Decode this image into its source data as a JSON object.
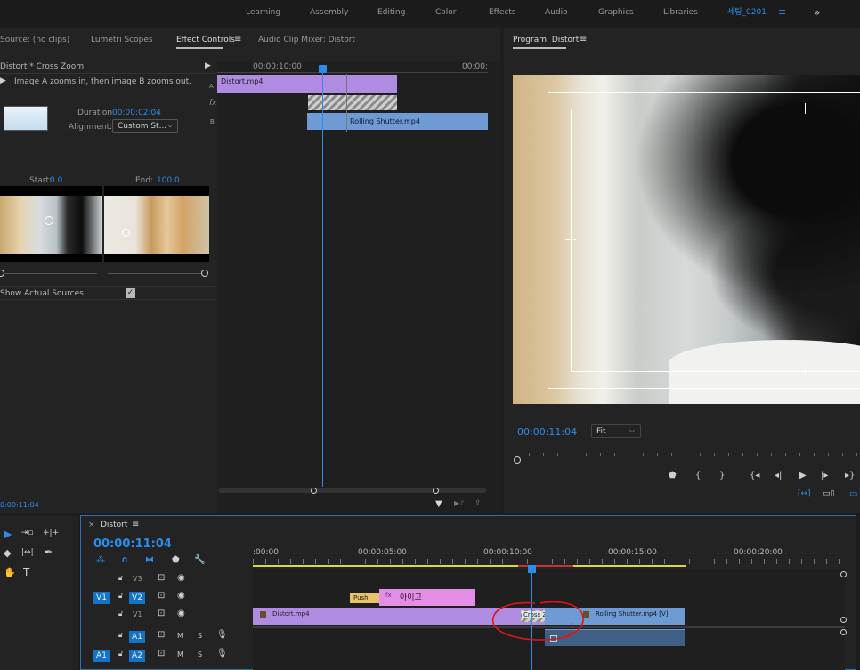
{
  "workspace": {
    "items": [
      "Learning",
      "Assembly",
      "Editing",
      "Color",
      "Effects",
      "Audio",
      "Graphics",
      "Libraries"
    ],
    "active": "세팅_0201",
    "menu_icon": "≡",
    "overflow": "»"
  },
  "source_panel": {
    "tabs": [
      "Source: (no clips)",
      "Lumetri Scopes",
      "Effect Controls",
      "Audio Clip Mixer: Distort"
    ],
    "active_tab_menu": "≡"
  },
  "effect_controls": {
    "header": "Distort * Cross Zoom",
    "description": "Image A zooms in, then image B zooms out.",
    "duration_label": "Duration",
    "duration_value": "00:00:02:04",
    "alignment_label": "Alignment:",
    "alignment_value": "Custom St...",
    "start_label": "Start:",
    "start_value": "0.0",
    "end_label": "End:",
    "end_value": "100.0",
    "show_actual_sources": "Show Actual Sources",
    "show_actual_checked": true,
    "timecode": "0:00:11:04",
    "mini_timeline": {
      "time_left": "00:00:10:00",
      "time_right": "00:00:",
      "track_a": "A",
      "track_fx": "fx",
      "track_b": "B",
      "clip_a": "Distort.mp4",
      "clip_b": "Rolling Shutter.mp4"
    }
  },
  "program_monitor": {
    "title": "Program: Distort",
    "menu_icon": "≡",
    "timecode": "00:00:11:04",
    "fit": "Fit"
  },
  "timeline": {
    "sequence_name": "Distort",
    "close": "×",
    "menu_icon": "≡",
    "timecode": "00:00:11:04",
    "ruler": [
      ":00:00",
      "00:00:05:00",
      "00:00:10:00",
      "00:00:15:00",
      "00:00:20:00"
    ],
    "tracks": [
      {
        "name": "V3",
        "source": ""
      },
      {
        "name": "V2",
        "source": "V1"
      },
      {
        "name": "V1",
        "source": ""
      },
      {
        "name": "A1",
        "source": ""
      },
      {
        "name": "A2",
        "source": "A1"
      }
    ],
    "clips": {
      "push": "Push",
      "title": "아이고",
      "distort": "Distort.mp4",
      "cross_zoom": "Cross Zoom",
      "rolling": "Rolling Shutter.mp4 [V]"
    },
    "audio_btn_m": "M",
    "audio_btn_s": "S"
  },
  "colors": {
    "accent": "#2d8ceb",
    "clip_video": "#b08be2",
    "clip_blue": "#6f9bd5",
    "clip_pink": "#e58ee6",
    "annotation": "#e01515"
  }
}
